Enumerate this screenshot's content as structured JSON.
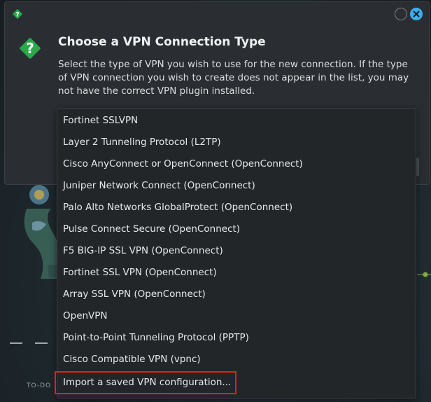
{
  "dialog": {
    "title": "Choose a VPN Connection Type",
    "description": "Select the type of VPN you wish to use for the new connection. If the type of VPN connection you wish to create does not appear in the list, you may not have the correct VPN plugin installed."
  },
  "vpn_types": [
    "Fortinet SSLVPN",
    "Layer 2 Tunneling Protocol (L2TP)",
    "Cisco AnyConnect or OpenConnect (OpenConnect)",
    "Juniper Network Connect (OpenConnect)",
    "Palo Alto Networks GlobalProtect (OpenConnect)",
    "Pulse Connect Secure (OpenConnect)",
    "F5 BIG-IP SSL VPN (OpenConnect)",
    "Fortinet SSL VPN (OpenConnect)",
    "Array SSL VPN (OpenConnect)",
    "OpenVPN",
    "Point-to-Point Tunneling Protocol (PPTP)",
    "Cisco Compatible VPN (vpnc)",
    "Import a saved VPN configuration..."
  ],
  "highlighted_item": "Import a saved VPN configuration...",
  "background": {
    "todo_label": "TO-DO"
  },
  "colors": {
    "accent": "#3daee9",
    "highlight_border": "#e0201e",
    "question_icon": "#2ba84a",
    "window_bg": "#2a2e32",
    "list_bg": "#232629"
  },
  "icons": {
    "titlebar": "question-icon",
    "dialog": "question-icon",
    "close": "close-icon",
    "minimize": "minimize-icon"
  }
}
